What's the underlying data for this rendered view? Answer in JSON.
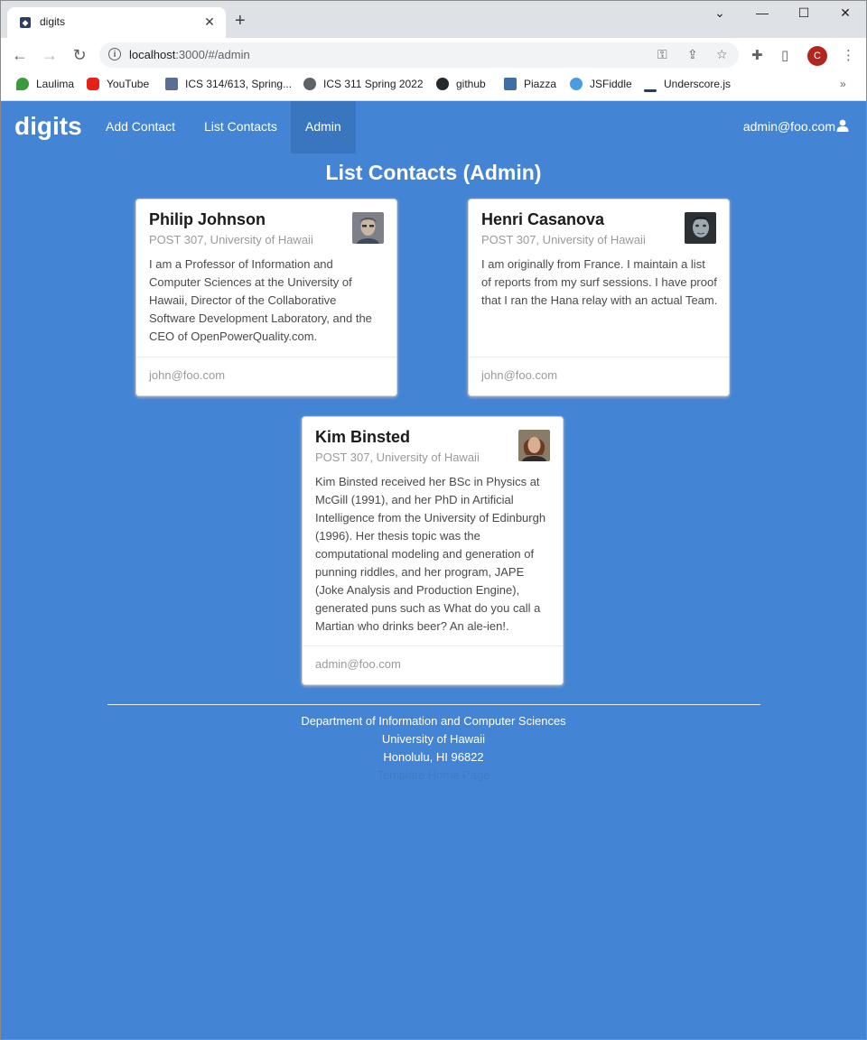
{
  "browser": {
    "tab_title": "digits",
    "url_host": "localhost",
    "url_rest": ":3000/#/admin",
    "profile_initial": "C",
    "bookmarks": [
      {
        "label": "Laulima",
        "color": "#3b9a3b"
      },
      {
        "label": "YouTube",
        "color": "#e62117"
      },
      {
        "label": "ICS 314/613, Spring...",
        "color": "#5a6e95"
      },
      {
        "label": "ICS 311 Spring 2022",
        "color": "#5f6368"
      },
      {
        "label": "github",
        "color": "#24292e"
      },
      {
        "label": "Piazza",
        "color": "#3d6fa3"
      },
      {
        "label": "JSFiddle",
        "color": "#4a9de0"
      },
      {
        "label": "Underscore.js",
        "color": "#1e3f6d"
      }
    ]
  },
  "app": {
    "brand": "digits",
    "nav": {
      "add_contact": "Add Contact",
      "list_contacts": "List Contacts",
      "admin": "Admin"
    },
    "user_email": "admin@foo.com",
    "page_title": "List Contacts (Admin)",
    "contacts": [
      {
        "name": "Philip Johnson",
        "address": "POST 307, University of Hawaii",
        "description": "I am a Professor of Information and Computer Sciences at the University of Hawaii, Director of the Collaborative Software Development Laboratory, and the CEO of OpenPowerQuality.com.",
        "owner": "john@foo.com"
      },
      {
        "name": "Henri Casanova",
        "address": "POST 307, University of Hawaii",
        "description": "I am originally from France. I maintain a list of reports from my surf sessions. I have proof that I ran the Hana relay with an actual Team.",
        "owner": "john@foo.com"
      },
      {
        "name": "Kim Binsted",
        "address": "POST 307, University of Hawaii",
        "description": "Kim Binsted received her BSc in Physics at McGill (1991), and her PhD in Artificial Intelligence from the University of Edinburgh (1996). Her thesis topic was the computational modeling and generation of punning riddles, and her program, JAPE (Joke Analysis and Production Engine), generated puns such as What do you call a Martian who drinks beer? An ale-ien!.",
        "owner": "admin@foo.com"
      }
    ],
    "footer": {
      "line1": "Department of Information and Computer Sciences",
      "line2": "University of Hawaii",
      "line3": "Honolulu, HI 96822",
      "line4": "Template Home Page"
    }
  },
  "colors": {
    "page_bg": "#4385d4",
    "nav_active_bg": "#3a76bf"
  }
}
